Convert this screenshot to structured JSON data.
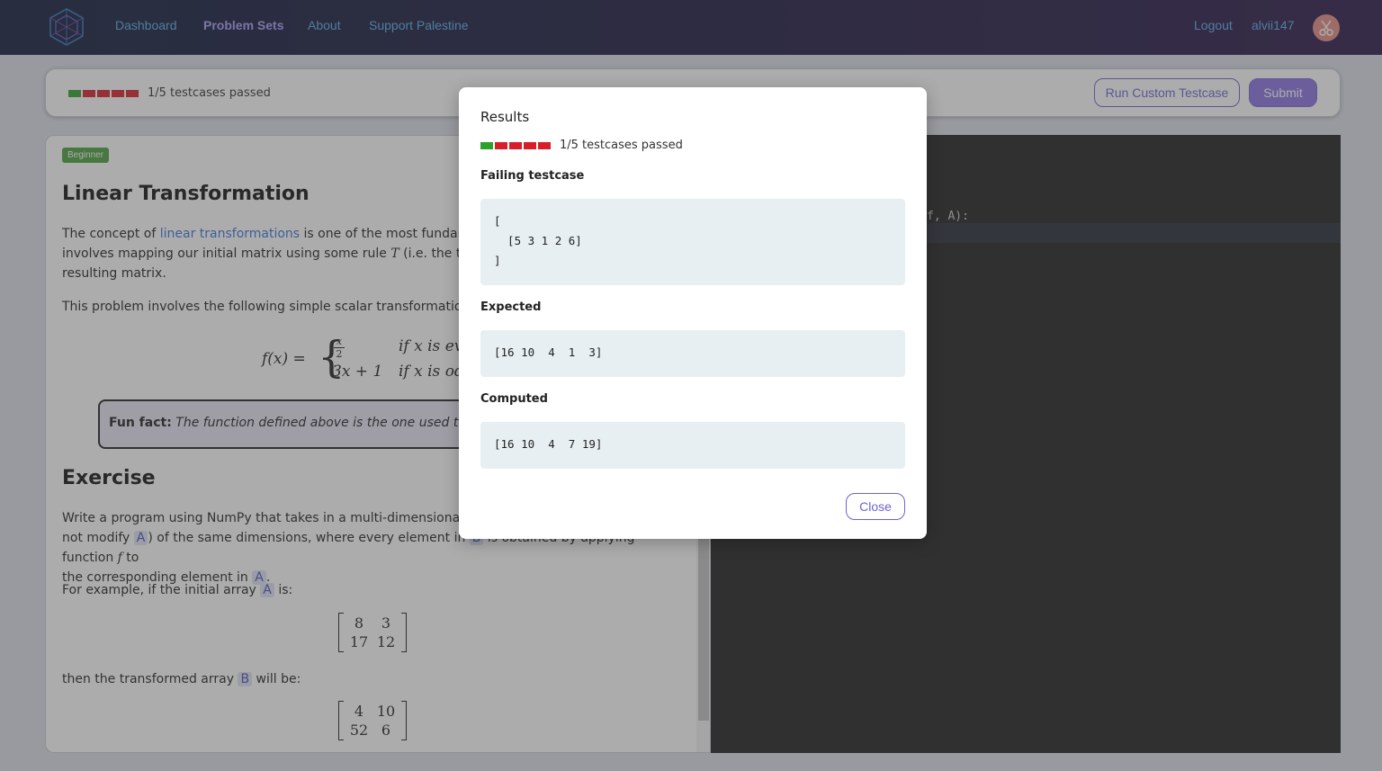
{
  "nav": {
    "links": [
      "Dashboard",
      "Problem Sets",
      "About",
      "Support Palestine"
    ],
    "logout": "Logout",
    "username": "alvii147"
  },
  "toolbar": {
    "progress_text": "1/5 testcases passed",
    "results": [
      "pass",
      "fail",
      "fail",
      "fail",
      "fail"
    ],
    "run_custom_label": "Run Custom Testcase",
    "submit_label": "Submit"
  },
  "problem": {
    "difficulty": "Beginner",
    "title": "Linear Transformation",
    "intro_pre": "The concept of ",
    "intro_link": "linear transformations",
    "intro_post": " is one of the most fundamenta",
    "intro_line2_pre": "involves mapping our initial matrix using some rule ",
    "intro_line2_var": "T",
    "intro_line2_post": " (i.e. the transf",
    "intro_line3": "resulting matrix.",
    "scalar_line": "This problem involves the following simple scalar transformation fun",
    "func_lhs": "f(x) =",
    "case1_expr_num": "x",
    "case1_expr_den": "2",
    "case1_cond": "if x is ev",
    "case2_expr": "3x + 1",
    "case2_cond": "if x is od",
    "funfact_label": "Fun fact:",
    "funfact_text": " The function defined above is the one used to form",
    "exercise_title": "Exercise",
    "ex_line1": "Write a program using NumPy that takes in a multi-dimensional array",
    "ex_line2_a": "not modify ",
    "ex_line2_b": ") of the same dimensions, where every element in ",
    "ex_line2_c": " is obtained by applying function ",
    "ex_line2_d": " to",
    "ex_line3_a": "the corresponding element in ",
    "ex_line3_b": ".",
    "var_A": "A",
    "var_B": "B",
    "var_f": "f",
    "example_a": "For example, if the initial array ",
    "example_b": " is:",
    "matrix_A": [
      [
        "8",
        "3"
      ],
      [
        "17",
        "12"
      ]
    ],
    "then_a": "then the transformed array ",
    "then_b": " will be:",
    "matrix_B": [
      [
        "4",
        "10"
      ],
      [
        "52",
        "6"
      ]
    ]
  },
  "editor": {
    "visible_code": "f, A):"
  },
  "modal": {
    "title": "Results",
    "progress_text": "1/5 testcases passed",
    "failing_label": "Failing testcase",
    "failing_value": "[\n  [5 3 1 2 6]\n]",
    "expected_label": "Expected",
    "expected_value": "[16 10  4  1  3]",
    "computed_label": "Computed",
    "computed_value": "[16 10  4  7 19]",
    "close_label": "Close"
  }
}
